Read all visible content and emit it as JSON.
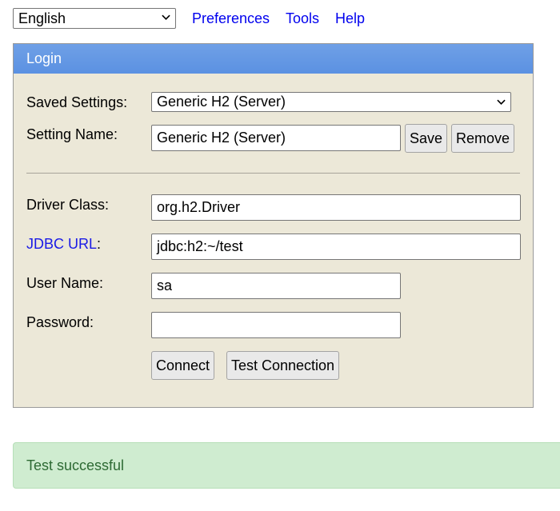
{
  "topbar": {
    "language_selected": "English",
    "links": {
      "preferences": "Preferences",
      "tools": "Tools",
      "help": "Help"
    }
  },
  "login": {
    "title": "Login",
    "saved_settings": {
      "label": "Saved Settings:",
      "selected": "Generic H2 (Server)"
    },
    "setting_name": {
      "label": "Setting Name:",
      "value": "Generic H2 (Server)",
      "save_label": "Save",
      "remove_label": "Remove"
    },
    "driver_class": {
      "label": "Driver Class:",
      "value": "org.h2.Driver"
    },
    "jdbc_url": {
      "link_label": "JDBC URL",
      "suffix": ":",
      "value": "jdbc:h2:~/test"
    },
    "user_name": {
      "label": "User Name:",
      "value": "sa"
    },
    "password": {
      "label": "Password:",
      "value": ""
    },
    "connect_label": "Connect",
    "test_connection_label": "Test Connection"
  },
  "status": {
    "message": "Test successful",
    "color": "#2d6a33",
    "background": "#cfecd0"
  },
  "colors": {
    "header_blue": "#5b91e2",
    "panel_bg": "#ece8d8",
    "link": "#0000ee"
  }
}
